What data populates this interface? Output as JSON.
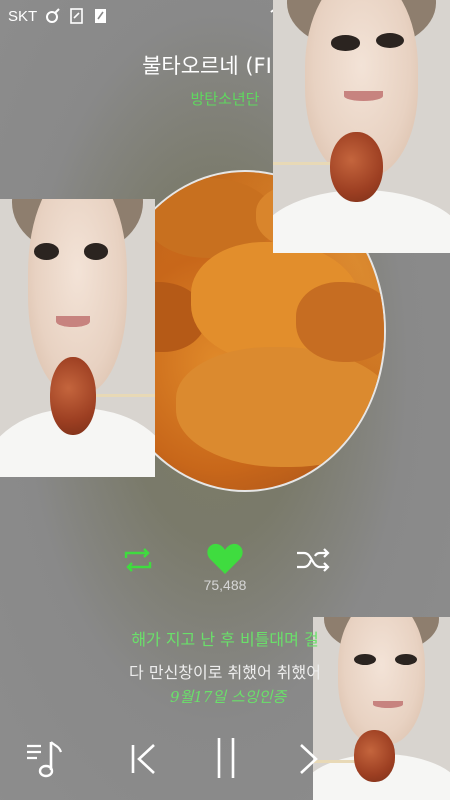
{
  "status_bar": {
    "carrier": "SKT"
  },
  "song": {
    "title": "불타오르네 (FIRE)",
    "artist": "방탄소년단"
  },
  "player": {
    "like_count": "75,488",
    "accent_color": "#3fdc3f"
  },
  "lyrics": {
    "current_line": "해가 지고 난 후 비틀대며 걸",
    "next_line": "다 만신창이로 취했어 취했어"
  },
  "overlay": {
    "signature": "9월17일 스잉인증"
  },
  "icons": {
    "repeat": "repeat-icon",
    "heart": "heart-icon",
    "shuffle": "shuffle-icon",
    "playlist": "playlist-icon",
    "previous": "previous-icon",
    "pause": "pause-icon",
    "next": "next-icon"
  }
}
